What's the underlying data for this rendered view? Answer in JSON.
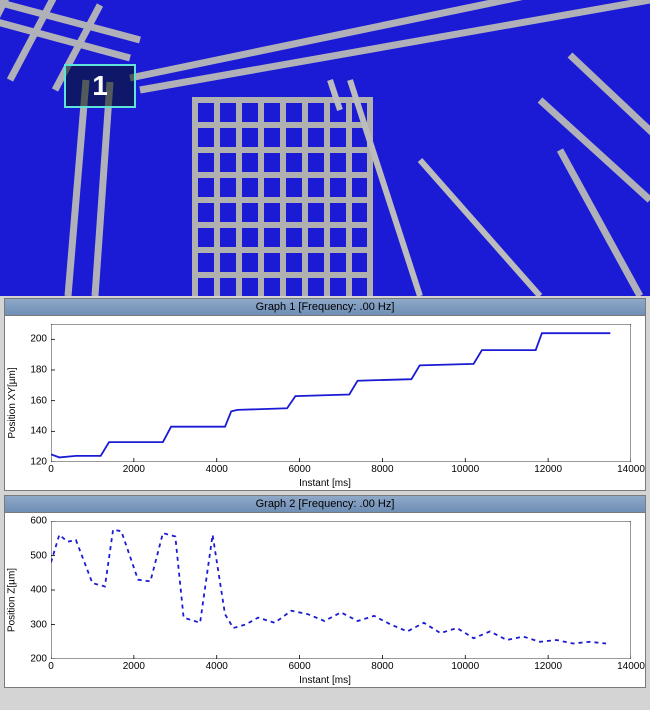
{
  "viewport": {
    "marker_label": "1"
  },
  "graph1": {
    "title": "Graph 1 [Frequency: .00 Hz]",
    "xlabel": "Instant [ms]",
    "ylabel": "Position XY[µm]"
  },
  "graph2": {
    "title": "Graph 2 [Frequency: .00 Hz]",
    "xlabel": "Instant [ms]",
    "ylabel": "Position Z[µm]"
  },
  "chart_data": [
    {
      "type": "line",
      "title": "Graph 1 [Frequency: .00 Hz]",
      "xlabel": "Instant [ms]",
      "ylabel": "Position XY[µm]",
      "xlim": [
        0,
        14000
      ],
      "ylim": [
        120,
        210
      ],
      "xticks": [
        0,
        2000,
        4000,
        6000,
        8000,
        10000,
        12000,
        14000
      ],
      "yticks": [
        120,
        140,
        160,
        180,
        200
      ],
      "line_style": "solid",
      "color": "#1b1bd6",
      "series": [
        {
          "name": "Position XY",
          "x": [
            0,
            200,
            600,
            1200,
            1400,
            2700,
            2900,
            4200,
            4350,
            4500,
            5700,
            5900,
            7200,
            7400,
            8700,
            8900,
            10200,
            10400,
            11700,
            11850,
            12000,
            13500
          ],
          "y": [
            125,
            123,
            124,
            124,
            133,
            133,
            143,
            143,
            153,
            154,
            155,
            163,
            164,
            173,
            174,
            183,
            184,
            193,
            193,
            204,
            204,
            204
          ]
        }
      ]
    },
    {
      "type": "line",
      "title": "Graph 2 [Frequency: .00 Hz]",
      "xlabel": "Instant [ms]",
      "ylabel": "Position Z[µm]",
      "xlim": [
        0,
        14000
      ],
      "ylim": [
        200,
        600
      ],
      "xticks": [
        0,
        2000,
        4000,
        6000,
        8000,
        10000,
        12000,
        14000
      ],
      "yticks": [
        200,
        300,
        400,
        500,
        600
      ],
      "line_style": "dashed",
      "color": "#1b1bd6",
      "series": [
        {
          "name": "Position Z",
          "x": [
            0,
            200,
            400,
            600,
            1000,
            1300,
            1500,
            1700,
            2100,
            2400,
            2700,
            3000,
            3200,
            3600,
            3900,
            4200,
            4400,
            4700,
            5000,
            5400,
            5800,
            6200,
            6600,
            7000,
            7400,
            7800,
            8200,
            8600,
            9000,
            9400,
            9800,
            10200,
            10600,
            11000,
            11400,
            11800,
            12200,
            12600,
            13000,
            13400
          ],
          "y": [
            480,
            560,
            540,
            545,
            420,
            410,
            575,
            570,
            430,
            425,
            565,
            555,
            320,
            305,
            560,
            330,
            290,
            300,
            320,
            305,
            340,
            330,
            310,
            335,
            310,
            325,
            300,
            280,
            305,
            275,
            290,
            260,
            280,
            255,
            265,
            250,
            255,
            245,
            250,
            245
          ]
        }
      ]
    }
  ]
}
